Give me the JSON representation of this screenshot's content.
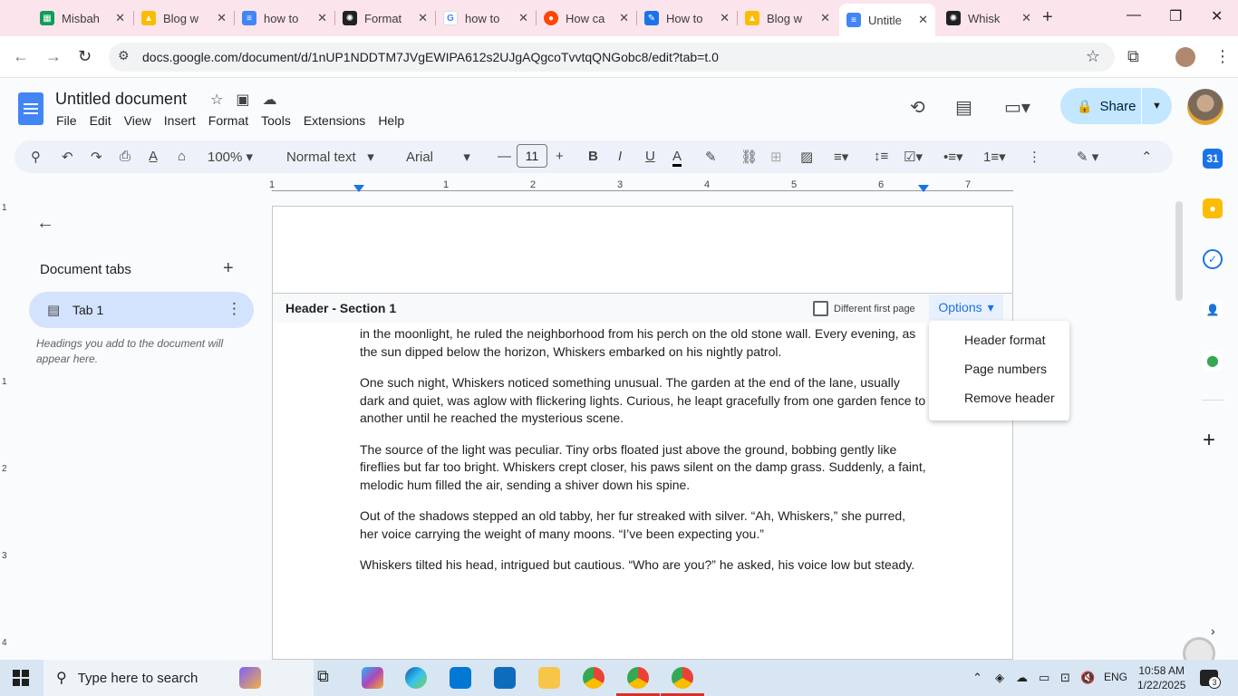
{
  "browser": {
    "tabs": [
      {
        "label": "Misbah",
        "color": "#0f9d58",
        "glyph": "▦"
      },
      {
        "label": "Blog w",
        "color": "#fbbc04",
        "glyph": "▲"
      },
      {
        "label": "how to",
        "color": "#4285f4",
        "glyph": "≡"
      },
      {
        "label": "Format",
        "color": "#202124",
        "glyph": "✺"
      },
      {
        "label": "how to",
        "color": "#ffffff",
        "glyph": "G"
      },
      {
        "label": "How ca",
        "color": "#ff4500",
        "glyph": "●"
      },
      {
        "label": "How to",
        "color": "#1a73e8",
        "glyph": "✎"
      },
      {
        "label": "Blog w",
        "color": "#fbbc04",
        "glyph": "▲"
      },
      {
        "label": "Untitle",
        "color": "#4285f4",
        "glyph": "≡"
      },
      {
        "label": "Whisk",
        "color": "#202124",
        "glyph": "✺"
      }
    ],
    "new_tab": "+",
    "minimize": "—",
    "maximize": "❐",
    "close": "✕",
    "url": "docs.google.com/document/d/1nUP1NDDTM7JVgEWIPA612s2UJgAQgcoTvvtqQNGobc8/edit?tab=t.0"
  },
  "docs": {
    "title": "Untitled document",
    "menu": [
      "File",
      "Edit",
      "View",
      "Insert",
      "Format",
      "Tools",
      "Extensions",
      "Help"
    ],
    "share_label": "Share",
    "toolbar": {
      "zoom": "100%",
      "style": "Normal text",
      "font": "Arial",
      "font_size": "11"
    }
  },
  "ruler": {
    "labels": [
      "1",
      "1",
      "2",
      "3",
      "4",
      "5",
      "6",
      "7"
    ],
    "vertical_labels": [
      "1",
      "1",
      "2",
      "3",
      "4"
    ]
  },
  "sidebar": {
    "heading": "Document tabs",
    "tab_label": "Tab 1",
    "hint": "Headings you add to the document will appear here."
  },
  "page": {
    "header_label": "Header - Section 1",
    "different_first_page": "Different first page",
    "options_label": "Options",
    "paragraphs": [
      "in the moonlight, he ruled the neighborhood from his perch on the old stone wall. Every evening, as the sun dipped below the horizon, Whiskers embarked on his nightly patrol.",
      "One such night, Whiskers noticed something unusual. The garden at the end of the lane, usually dark and quiet, was aglow with flickering lights. Curious, he leapt gracefully from one garden fence to another until he reached the mysterious scene.",
      "The source of the light was peculiar. Tiny orbs floated just above the ground, bobbing gently like fireflies but far too bright. Whiskers crept closer, his paws silent on the damp grass. Suddenly, a faint, melodic hum filled the air, sending a shiver down his spine.",
      "Out of the shadows stepped an old tabby, her fur streaked with silver. “Ah, Whiskers,” she purred, her voice carrying the weight of many moons. “I’ve been expecting you.”",
      "Whiskers tilted his head, intrigued but cautious. “Who are you?” he asked, his voice low but steady."
    ]
  },
  "options_menu": {
    "items": [
      "Header format",
      "Page numbers",
      "Remove header"
    ]
  },
  "taskbar": {
    "search_placeholder": "Type here to search",
    "language": "ENG",
    "time": "10:58 AM",
    "date": "1/22/2025",
    "notification_count": "3"
  }
}
